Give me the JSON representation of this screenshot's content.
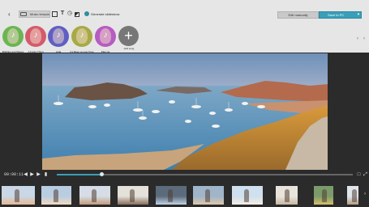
{
  "toolbar": {
    "music_templates_label": "Music templates",
    "generate_slideshow_label": "Generate slideshow",
    "edit_manually_label": "Edit manually",
    "save_to_pc_label": "Save to PC"
  },
  "music": {
    "items": [
      {
        "label": "Bubbles and Waves",
        "color": "#6bb552"
      },
      {
        "label": "A Funky Thing",
        "color": "#d45b6b"
      },
      {
        "label": "Lolla",
        "color": "#5f5fc4"
      },
      {
        "label": "It's Been a Long Time",
        "color": "#a7aa45"
      },
      {
        "label": "Plan Us",
        "color": "#b65cc2"
      }
    ],
    "add_label": "Add song"
  },
  "playback": {
    "time": "00:00:11",
    "progress": 0.15
  },
  "thumbnails": {
    "count": 11
  }
}
